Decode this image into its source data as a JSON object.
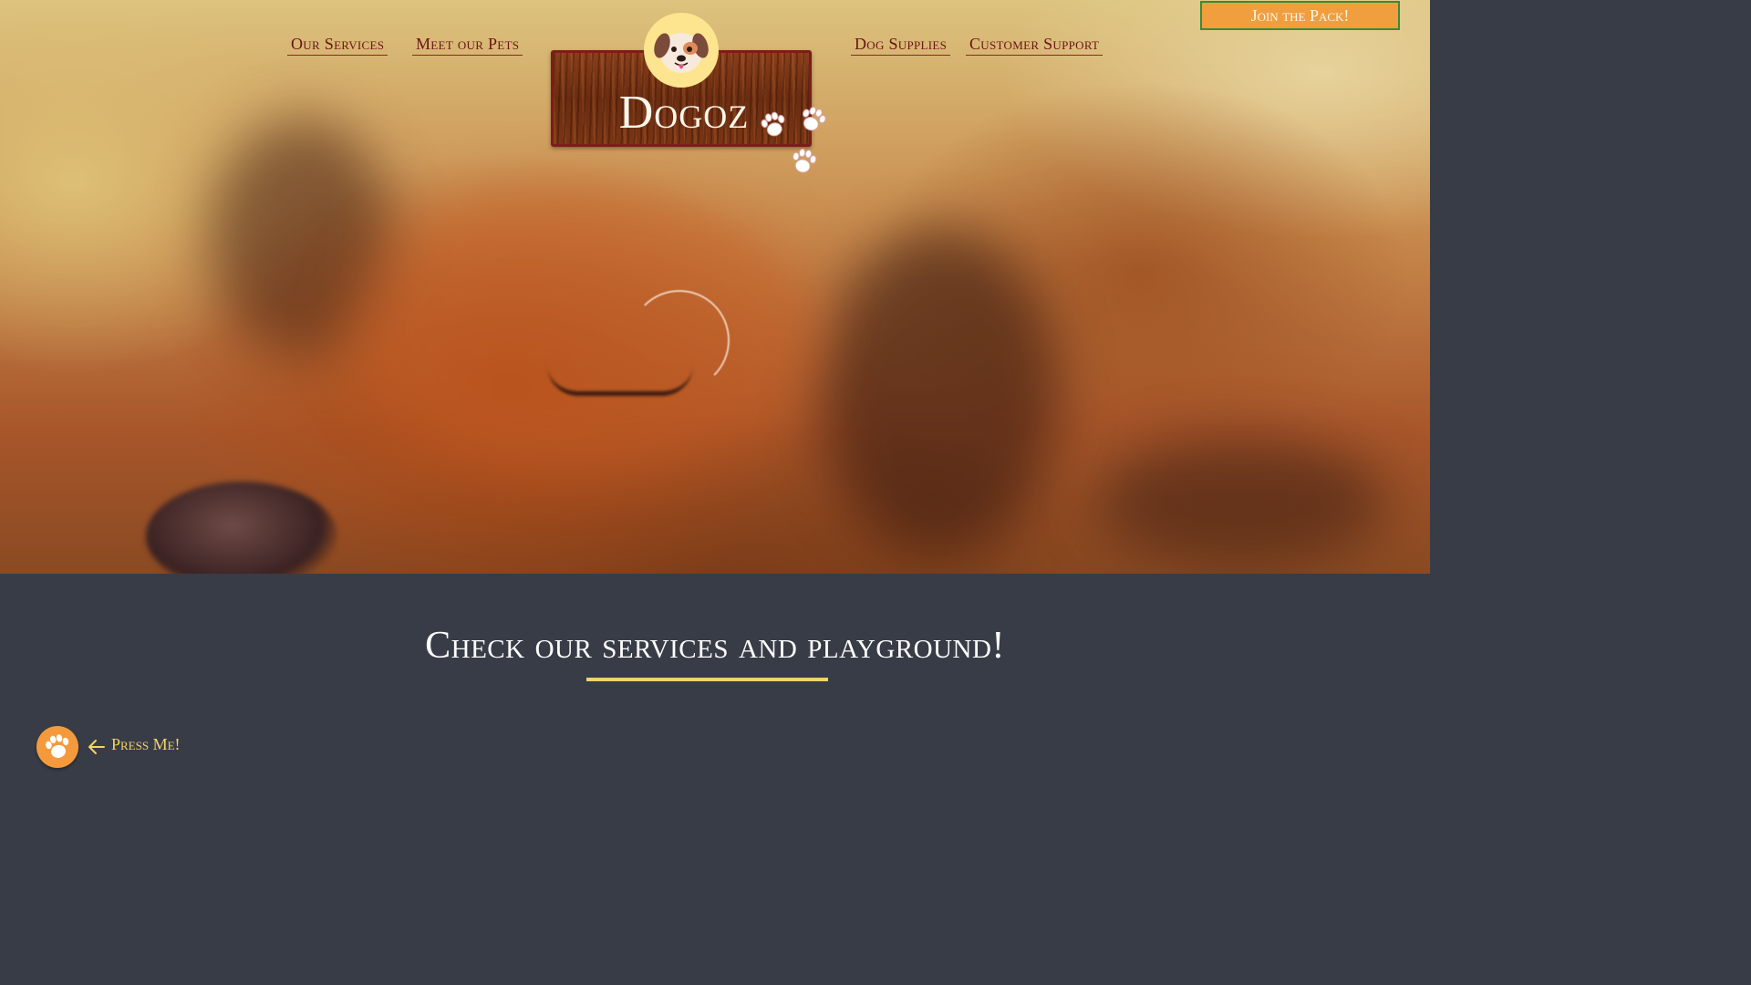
{
  "nav": {
    "left": [
      {
        "label": "Our Services"
      },
      {
        "label": "Meet our Pets"
      }
    ],
    "right": [
      {
        "label": "Dog Supplies"
      },
      {
        "label": "Customer Support"
      }
    ],
    "cta_label": "Join the Pack!"
  },
  "brand": {
    "name": "Dogoz",
    "avatar_icon": "dog-face-icon",
    "paw_icon": "paw-print-icon"
  },
  "hero": {
    "image": "sleeping-dog-photo"
  },
  "section": {
    "title": "Check our services and playground!",
    "press_label": "Press Me!",
    "press_icon": "paw-print-icon",
    "arrow_icon": "arrow-left-icon"
  },
  "colors": {
    "nav_text": "#6b1414",
    "cta_bg": "#f19e3e",
    "cta_border": "#3b8a3a",
    "board_border": "#7d1c1c",
    "avatar_bg": "#fde58f",
    "section_bg": "#383c47",
    "accent_yellow": "#f3d36b",
    "press_button_bg": "#f59a3c"
  }
}
